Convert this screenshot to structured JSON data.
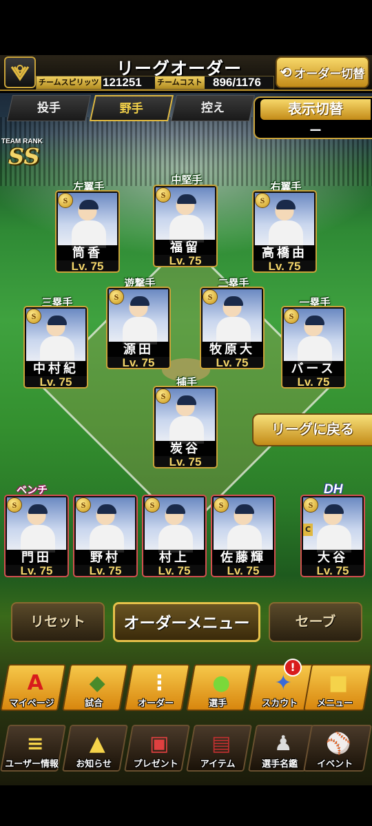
{
  "header": {
    "title": "リーグオーダー",
    "team_spirit_label": "チームスピリッツ",
    "team_spirit_value": "121251",
    "team_cost_label": "チームコスト",
    "team_cost_value": "896/1176",
    "order_switch_label": "オーダー切替"
  },
  "tabs": [
    {
      "label": "投手",
      "active": false
    },
    {
      "label": "野手",
      "active": true
    },
    {
      "label": "控え",
      "active": false
    }
  ],
  "display_toggle": {
    "title": "表示切替",
    "value": "ー"
  },
  "team_rank": {
    "label": "TEAM RANK",
    "value": "SS"
  },
  "positions": {
    "lf": "左翼手",
    "cf": "中堅手",
    "rf": "右翼手",
    "ss": "遊撃手",
    "b2": "二塁手",
    "b3": "三塁手",
    "b1": "一塁手",
    "c": "捕手"
  },
  "field_players": {
    "lf": {
      "name": "筒香",
      "level": "Lv. 75",
      "rank": "S"
    },
    "cf": {
      "name": "福留",
      "level": "Lv. 75",
      "rank": "S"
    },
    "rf": {
      "name": "高橋由",
      "level": "Lv. 75",
      "rank": "S"
    },
    "ss": {
      "name": "源田",
      "level": "Lv. 75",
      "rank": "S"
    },
    "b2": {
      "name": "牧原大",
      "level": "Lv. 75",
      "rank": "S"
    },
    "b3": {
      "name": "中村紀",
      "level": "Lv. 75",
      "rank": "S"
    },
    "b1": {
      "name": "バース",
      "level": "Lv. 75",
      "rank": "S"
    },
    "c": {
      "name": "炭谷",
      "level": "Lv. 75",
      "rank": "S"
    }
  },
  "back_to_league_label": "リーグに戻る",
  "bench": {
    "label": "ベンチ",
    "players": [
      {
        "name": "門田",
        "level": "Lv. 75",
        "rank": "S"
      },
      {
        "name": "野村",
        "level": "Lv. 75",
        "rank": "S"
      },
      {
        "name": "村上",
        "level": "Lv. 75",
        "rank": "S"
      },
      {
        "name": "佐藤輝",
        "level": "Lv. 75",
        "rank": "S"
      }
    ]
  },
  "dh": {
    "label": "DH",
    "player": {
      "name": "大谷",
      "level": "Lv. 75",
      "rank": "S",
      "badge": "C"
    }
  },
  "actions": {
    "reset": "リセット",
    "order_menu": "オーダーメニュー",
    "save": "セーブ"
  },
  "menu_row1": [
    {
      "label": "マイページ",
      "icon": "A"
    },
    {
      "label": "試合",
      "icon": "◆"
    },
    {
      "label": "オーダー",
      "icon": "⋮"
    },
    {
      "label": "選手",
      "icon": "●"
    },
    {
      "label": "スカウト",
      "icon": "✦"
    },
    {
      "label": "メニュー",
      "icon": "■"
    }
  ],
  "menu_row2": [
    {
      "label": "ユーザー情報",
      "icon": "≡"
    },
    {
      "label": "お知らせ",
      "icon": "▲"
    },
    {
      "label": "プレゼント",
      "icon": "▣"
    },
    {
      "label": "アイテム",
      "icon": "▤"
    },
    {
      "label": "選手名鑑",
      "icon": "♟"
    },
    {
      "label": "イベント",
      "icon": "⚾"
    }
  ],
  "scout_notification": "!",
  "colors": {
    "gold": "#e0b840",
    "accent_red": "#d81c1c"
  }
}
